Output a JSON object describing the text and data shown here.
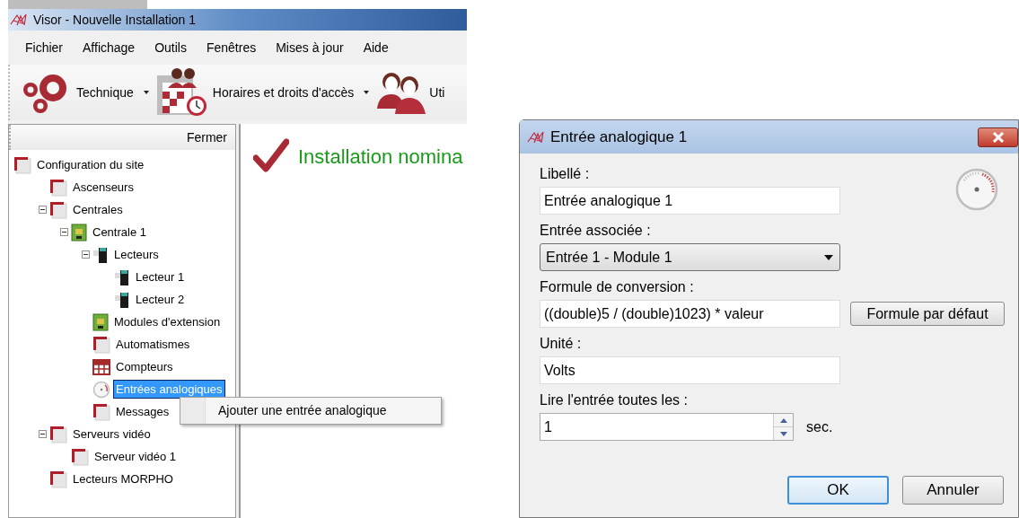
{
  "main_window": {
    "title": "Visor - Nouvelle Installation 1",
    "menu": [
      "Fichier",
      "Affichage",
      "Outils",
      "Fenêtres",
      "Mises à jour",
      "Aide"
    ],
    "toolbar": [
      {
        "label": "Technique",
        "kind": "gears",
        "dropdown": true
      },
      {
        "label": "Horaires et droits d'accès",
        "kind": "calendar",
        "dropdown": true
      },
      {
        "label": "Uti",
        "kind": "users",
        "dropdown": false
      }
    ],
    "tree_panel": {
      "close_label": "Fermer",
      "items": [
        {
          "label": "Configuration du site",
          "kind": "corner",
          "selected": false,
          "children": [
            {
              "label": "Ascenseurs",
              "kind": "corner",
              "selected": false
            },
            {
              "label": "Centrales",
              "kind": "corner",
              "selected": false,
              "expanded": true,
              "children": [
                {
                  "label": "Centrale 1",
                  "kind": "board",
                  "selected": false,
                  "expanded": true,
                  "children": [
                    {
                      "label": "Lecteurs",
                      "kind": "reader",
                      "selected": false,
                      "expanded": true,
                      "children": [
                        {
                          "label": "Lecteur 1",
                          "kind": "reader",
                          "selected": false
                        },
                        {
                          "label": "Lecteur 2",
                          "kind": "reader",
                          "selected": false
                        }
                      ]
                    },
                    {
                      "label": "Modules d'extension",
                      "kind": "board",
                      "selected": false
                    },
                    {
                      "label": "Automatismes",
                      "kind": "corner",
                      "selected": false
                    },
                    {
                      "label": "Compteurs",
                      "kind": "grid",
                      "selected": false
                    },
                    {
                      "label": "Entrées analogiques",
                      "kind": "gauge",
                      "selected": true
                    },
                    {
                      "label": "Messages",
                      "kind": "corner",
                      "selected": false
                    }
                  ]
                }
              ]
            },
            {
              "label": "Serveurs vidéo",
              "kind": "corner",
              "selected": false,
              "expanded": true,
              "children": [
                {
                  "label": "Serveur vidéo 1",
                  "kind": "corner",
                  "selected": false
                }
              ]
            },
            {
              "label": "Lecteurs MORPHO",
              "kind": "corner",
              "selected": false
            }
          ]
        }
      ]
    },
    "context_menu": {
      "items": [
        "Ajouter une entrée analogique"
      ]
    },
    "content": {
      "status": "Installation nomina"
    }
  },
  "dialog": {
    "title": "Entrée analogique 1",
    "fields": [
      {
        "kind": "text",
        "label": "Libellé :",
        "value": "Entrée analogique 1"
      },
      {
        "kind": "select",
        "label": "Entrée associée :",
        "value": "Entrée 1 - Module 1"
      },
      {
        "kind": "text",
        "label": "Formule de conversion :",
        "value": "((double)5 / (double)1023) * valeur",
        "button": "Formule par défaut"
      },
      {
        "kind": "text",
        "label": "Unité :",
        "value": "Volts"
      },
      {
        "kind": "spinner",
        "label": "Lire l'entrée toutes les :",
        "value": "1",
        "unit": "sec."
      }
    ],
    "buttons": [
      {
        "label": "OK",
        "default": true
      },
      {
        "label": "Annuler",
        "default": false
      }
    ]
  }
}
